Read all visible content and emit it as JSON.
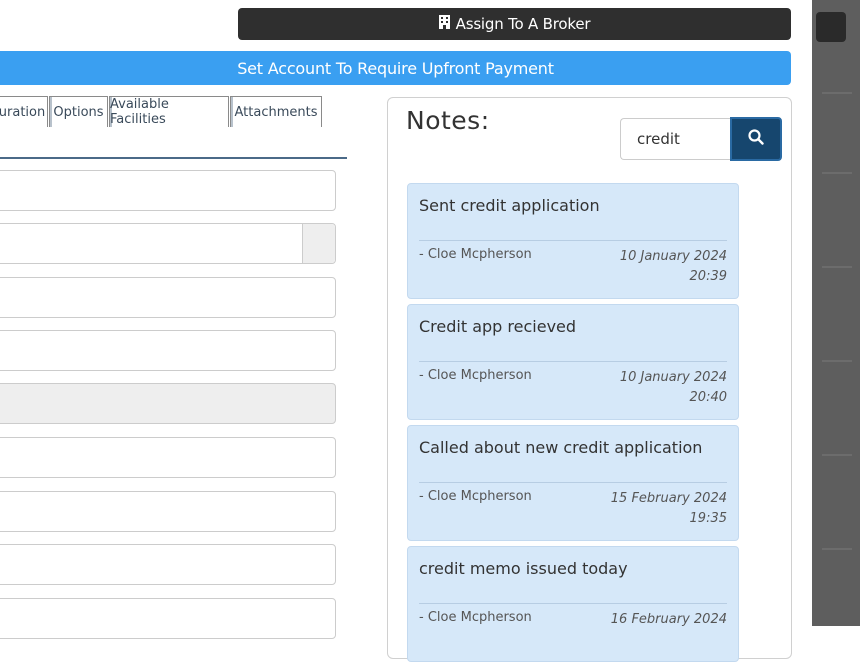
{
  "header": {
    "broker_button": "Assign To A Broker",
    "upfront_button": "Set Account To Require Upfront Payment"
  },
  "tabs": [
    {
      "label": "uration"
    },
    {
      "label": "Options"
    },
    {
      "label": "Available Facilities"
    },
    {
      "label": "Attachments"
    }
  ],
  "notes": {
    "title": "Notes:",
    "search_value": "credit",
    "items": [
      {
        "text": "Sent credit application",
        "author": "- Cloe Mcpherson",
        "date": "10 January 2024",
        "time": "20:39"
      },
      {
        "text": "Credit app recieved",
        "author": "- Cloe Mcpherson",
        "date": "10 January 2024",
        "time": "20:40"
      },
      {
        "text": "Called about new credit application",
        "author": "- Cloe Mcpherson",
        "date": "15 February 2024",
        "time": "19:35"
      },
      {
        "text": "credit memo issued today",
        "author": "- Cloe Mcpherson",
        "date": "16 February 2024",
        "time": ""
      }
    ]
  },
  "colors": {
    "broker_button": "#2f2f2f",
    "upfront_button": "#3a9ff1",
    "note_background": "#d6e8f9",
    "search_button": "#16466e"
  }
}
